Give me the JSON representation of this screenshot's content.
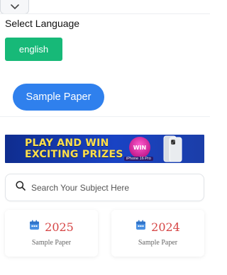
{
  "header": {
    "collapse_icon": "chevron-down-icon"
  },
  "language": {
    "label": "Select Language",
    "selected": "english",
    "accent": "#17b978"
  },
  "sample_paper_button": {
    "label": "Sample Paper",
    "color": "#2f80ed"
  },
  "banner": {
    "line1": "PLAY AND WIN",
    "line2": "EXCITING PRIZES",
    "badge": "WIN",
    "badge_caption": "iPhone 16 Pro"
  },
  "search": {
    "placeholder": "Search Your Subject Here",
    "icon": "search-icon"
  },
  "year_cards": [
    {
      "year": "2025",
      "subtitle": "Sample Paper",
      "icon": "calendar-icon"
    },
    {
      "year": "2024",
      "subtitle": "Sample Paper",
      "icon": "calendar-icon"
    }
  ],
  "colors": {
    "year_text": "#d64545",
    "calendar_icon": "#4a90e2"
  }
}
